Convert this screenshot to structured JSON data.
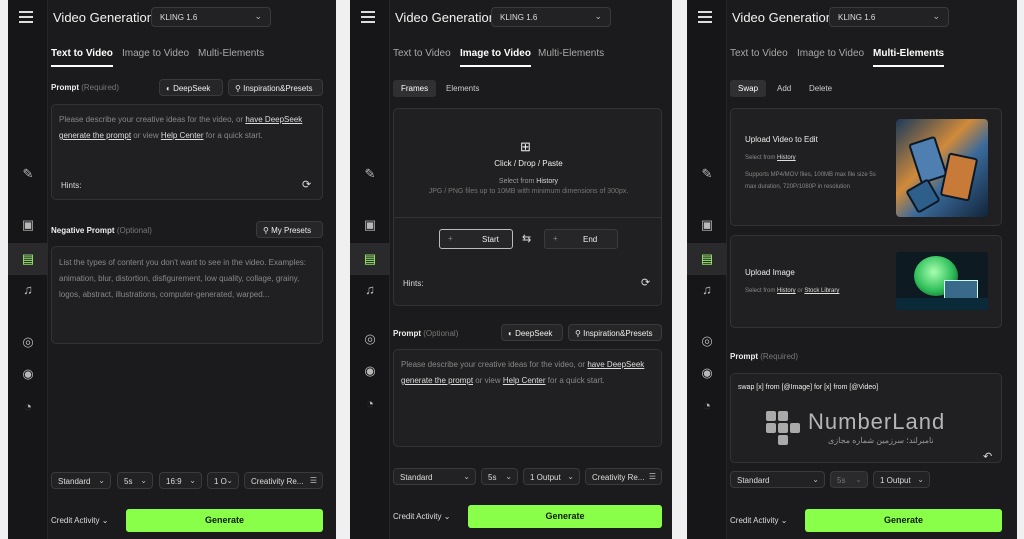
{
  "header": {
    "title": "Video Generation",
    "model": "KLING 1.6"
  },
  "tabs": [
    "Text to Video",
    "Image to Video",
    "Multi-Elements"
  ],
  "panel1": {
    "prompt_label": "Prompt",
    "prompt_req": "(Required)",
    "deepseek": "DeepSeek",
    "inspiration": "Inspiration&Presets",
    "prompt_ph1": "Please describe your creative ideas for the video, or",
    "prompt_link1": "have DeepSeek",
    "prompt_link2": "generate the prompt",
    "prompt_ph2": "or view",
    "prompt_link3": "Help Center",
    "prompt_ph3": "for a quick start.",
    "hints": "Hints:",
    "neg_label": "Negative Prompt",
    "neg_opt": "(Optional)",
    "my_presets": "My Presets",
    "neg_ph": "List the types of content you don't want to see in the video. Examples: animation, blur, distortion, disfigurement, low quality, collage, grainy, logos, abstract, illustrations, computer-generated, warped...",
    "mode": "Standard",
    "duration": "5s",
    "ratio": "16:9",
    "count": "1 O",
    "creativity": "Creativity Re...",
    "credit": "Credit Activity",
    "generate": "Generate"
  },
  "panel2": {
    "sub_frames": "Frames",
    "sub_elements": "Elements",
    "upload_title": "Click / Drop / Paste",
    "select_from": "Select from",
    "history": "History",
    "upload_note": "JPG / PNG files up to 10MB with minimum dimensions of 300px.",
    "start": "Start",
    "end": "End",
    "hints": "Hints:",
    "prompt_label": "Prompt",
    "prompt_opt": "(Optional)",
    "deepseek": "DeepSeek",
    "inspiration": "Inspiration&Presets",
    "mode": "Standard",
    "duration": "5s",
    "output": "1 Output",
    "creativity": "Creativity Re...",
    "credit": "Credit Activity",
    "generate": "Generate"
  },
  "panel3": {
    "swap": "Swap",
    "add": "Add",
    "delete": "Delete",
    "upload_video": "Upload Video to Edit",
    "select_from": "Select from",
    "history": "History",
    "video_note": "Supports MP4/MOV files, 100MB max file size 5s max duration, 720P/1080P in resolution",
    "upload_image": "Upload Image",
    "or": "or",
    "stock": "Stock Library",
    "prompt_label": "Prompt",
    "prompt_req": "(Required)",
    "prompt_text": "swap [x] from [@Image] for [x] from [@Video]",
    "mode": "Standard",
    "duration": "5s",
    "output": "1 Output",
    "credit": "Credit Activity",
    "generate": "Generate",
    "watermark": "NumberLand",
    "watermark_sub": "نامبرلند؛ سرزمین شماره مجازی"
  },
  "colors": {
    "accent": "#8aff4a",
    "bg": "#1b1b1d"
  }
}
